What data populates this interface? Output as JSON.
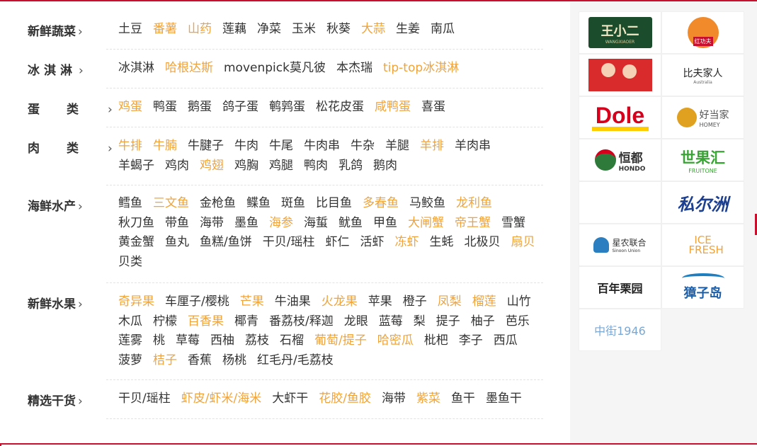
{
  "categories": [
    {
      "title": "新鲜蔬菜",
      "items": [
        {
          "label": "土豆",
          "hot": false
        },
        {
          "label": "番薯",
          "hot": true
        },
        {
          "label": "山药",
          "hot": true
        },
        {
          "label": "莲藕",
          "hot": false
        },
        {
          "label": "净菜",
          "hot": false
        },
        {
          "label": "玉米",
          "hot": false
        },
        {
          "label": "秋葵",
          "hot": false
        },
        {
          "label": "大蒜",
          "hot": true
        },
        {
          "label": "生姜",
          "hot": false
        },
        {
          "label": "南瓜",
          "hot": false
        }
      ]
    },
    {
      "title": "冰淇淋",
      "items": [
        {
          "label": "冰淇淋",
          "hot": false
        },
        {
          "label": "哈根达斯",
          "hot": true
        },
        {
          "label": "movenpick莫凡彼",
          "hot": false
        },
        {
          "label": "本杰瑞",
          "hot": false
        },
        {
          "label": "tip-top冰淇淋",
          "hot": true
        }
      ]
    },
    {
      "title": "蛋类",
      "items": [
        {
          "label": "鸡蛋",
          "hot": true
        },
        {
          "label": "鸭蛋",
          "hot": false
        },
        {
          "label": "鹅蛋",
          "hot": false
        },
        {
          "label": "鸽子蛋",
          "hot": false
        },
        {
          "label": "鹌鹑蛋",
          "hot": false
        },
        {
          "label": "松花皮蛋",
          "hot": false
        },
        {
          "label": "咸鸭蛋",
          "hot": true
        },
        {
          "label": "喜蛋",
          "hot": false
        }
      ]
    },
    {
      "title": "肉类",
      "items": [
        {
          "label": "牛排",
          "hot": true
        },
        {
          "label": "牛腩",
          "hot": true
        },
        {
          "label": "牛腱子",
          "hot": false
        },
        {
          "label": "牛肉",
          "hot": false
        },
        {
          "label": "牛尾",
          "hot": false
        },
        {
          "label": "牛肉串",
          "hot": false
        },
        {
          "label": "牛杂",
          "hot": false
        },
        {
          "label": "羊腿",
          "hot": false
        },
        {
          "label": "羊排",
          "hot": true
        },
        {
          "label": "羊肉串",
          "hot": false
        },
        {
          "label": "羊蝎子",
          "hot": false
        },
        {
          "label": "鸡肉",
          "hot": false
        },
        {
          "label": "鸡翅",
          "hot": true
        },
        {
          "label": "鸡胸",
          "hot": false
        },
        {
          "label": "鸡腿",
          "hot": false
        },
        {
          "label": "鸭肉",
          "hot": false
        },
        {
          "label": "乳鸽",
          "hot": false
        },
        {
          "label": "鹅肉",
          "hot": false
        }
      ]
    },
    {
      "title": "海鲜水产",
      "items": [
        {
          "label": "鳕鱼",
          "hot": false
        },
        {
          "label": "三文鱼",
          "hot": true
        },
        {
          "label": "金枪鱼",
          "hot": false
        },
        {
          "label": "鲽鱼",
          "hot": false
        },
        {
          "label": "斑鱼",
          "hot": false
        },
        {
          "label": "比目鱼",
          "hot": false
        },
        {
          "label": "多春鱼",
          "hot": true
        },
        {
          "label": "马鲛鱼",
          "hot": false
        },
        {
          "label": "龙利鱼",
          "hot": true
        },
        {
          "label": "秋刀鱼",
          "hot": false
        },
        {
          "label": "带鱼",
          "hot": false
        },
        {
          "label": "海带",
          "hot": false
        },
        {
          "label": "墨鱼",
          "hot": false
        },
        {
          "label": "海参",
          "hot": true
        },
        {
          "label": "海蜇",
          "hot": false
        },
        {
          "label": "鱿鱼",
          "hot": false
        },
        {
          "label": "甲鱼",
          "hot": false
        },
        {
          "label": "大闸蟹",
          "hot": true
        },
        {
          "label": "帝王蟹",
          "hot": true
        },
        {
          "label": "雪蟹",
          "hot": false
        },
        {
          "label": "黄金蟹",
          "hot": false
        },
        {
          "label": "鱼丸",
          "hot": false
        },
        {
          "label": "鱼糕/鱼饼",
          "hot": false
        },
        {
          "label": "干贝/瑶柱",
          "hot": false
        },
        {
          "label": "虾仁",
          "hot": false
        },
        {
          "label": "活虾",
          "hot": false
        },
        {
          "label": "冻虾",
          "hot": true
        },
        {
          "label": "生蚝",
          "hot": false
        },
        {
          "label": "北极贝",
          "hot": false
        },
        {
          "label": "扇贝",
          "hot": true
        },
        {
          "label": "贝类",
          "hot": false
        }
      ]
    },
    {
      "title": "新鲜水果",
      "items": [
        {
          "label": "奇异果",
          "hot": true
        },
        {
          "label": "车厘子/樱桃",
          "hot": false
        },
        {
          "label": "芒果",
          "hot": true
        },
        {
          "label": "牛油果",
          "hot": false
        },
        {
          "label": "火龙果",
          "hot": true
        },
        {
          "label": "苹果",
          "hot": false
        },
        {
          "label": "橙子",
          "hot": false
        },
        {
          "label": "凤梨",
          "hot": true
        },
        {
          "label": "榴莲",
          "hot": true
        },
        {
          "label": "山竹",
          "hot": false
        },
        {
          "label": "木瓜",
          "hot": false
        },
        {
          "label": "柠檬",
          "hot": false
        },
        {
          "label": "百香果",
          "hot": true
        },
        {
          "label": "椰青",
          "hot": false
        },
        {
          "label": "番荔枝/释迦",
          "hot": false
        },
        {
          "label": "龙眼",
          "hot": false
        },
        {
          "label": "蓝莓",
          "hot": false
        },
        {
          "label": "梨",
          "hot": false
        },
        {
          "label": "提子",
          "hot": false
        },
        {
          "label": "柚子",
          "hot": false
        },
        {
          "label": "芭乐",
          "hot": false
        },
        {
          "label": "莲雾",
          "hot": false
        },
        {
          "label": "桃",
          "hot": false
        },
        {
          "label": "草莓",
          "hot": false
        },
        {
          "label": "西柚",
          "hot": false
        },
        {
          "label": "荔枝",
          "hot": false
        },
        {
          "label": "石榴",
          "hot": false
        },
        {
          "label": "葡萄/提子",
          "hot": true
        },
        {
          "label": "哈密瓜",
          "hot": true
        },
        {
          "label": "枇杷",
          "hot": false
        },
        {
          "label": "李子",
          "hot": false
        },
        {
          "label": "西瓜",
          "hot": false
        },
        {
          "label": "菠萝",
          "hot": false
        },
        {
          "label": "桔子",
          "hot": true
        },
        {
          "label": "香蕉",
          "hot": false
        },
        {
          "label": "杨桃",
          "hot": false
        },
        {
          "label": "红毛丹/毛荔枝",
          "hot": false
        }
      ]
    },
    {
      "title": "精选干货",
      "items": [
        {
          "label": "干贝/瑶柱",
          "hot": false
        },
        {
          "label": "虾皮/虾米/海米",
          "hot": true
        },
        {
          "label": "大虾干",
          "hot": false
        },
        {
          "label": "花胶/鱼胶",
          "hot": true
        },
        {
          "label": "海带",
          "hot": false
        },
        {
          "label": "紫菜",
          "hot": true
        },
        {
          "label": "鱼干",
          "hot": false
        },
        {
          "label": "墨鱼干",
          "hot": false
        }
      ]
    }
  ],
  "arrow_glyph": "›",
  "brands": [
    {
      "name": "王小二",
      "sub": "WANGXIAOER"
    },
    {
      "name": "红功夫",
      "sub": ""
    },
    {
      "name": "",
      "sub": ""
    },
    {
      "name": "比夫家人",
      "sub": "Australia"
    },
    {
      "name": "Dole",
      "sub": ""
    },
    {
      "name": "好当家",
      "sub": "HOMEY"
    },
    {
      "name": "恒都",
      "sub": "HONDO"
    },
    {
      "name": "世果汇",
      "sub": "FRUITONE"
    },
    {
      "name": "",
      "sub": ""
    },
    {
      "name": "私尔洲",
      "sub": ""
    },
    {
      "name": "星农联合",
      "sub": "Sinoon Union"
    },
    {
      "name": "ICE FRESH",
      "sub": ""
    },
    {
      "name": "百年栗园",
      "sub": ""
    },
    {
      "name": "獐子岛",
      "sub": ""
    },
    {
      "name": "中街1946",
      "sub": ""
    }
  ],
  "colors": {
    "accent": "#f0a33a",
    "text": "#333333",
    "border": "#c8102e"
  }
}
